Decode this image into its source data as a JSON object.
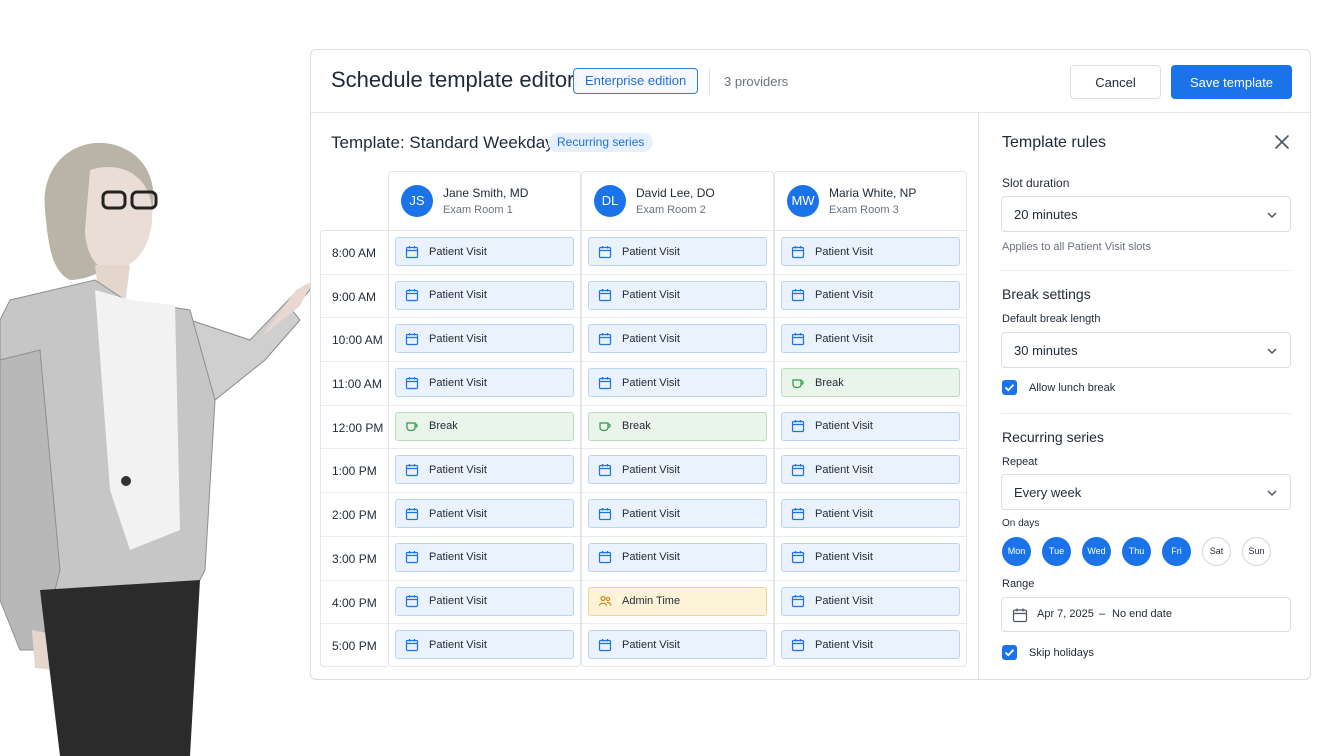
{
  "header": {
    "title": "Schedule template editor",
    "edition_badge": "Enterprise edition",
    "providers_count": "3 providers",
    "cancel_label": "Cancel",
    "save_label": "Save template"
  },
  "template": {
    "title": "Template: Standard Weekday",
    "badge": "Recurring series"
  },
  "times": [
    "8:00 AM",
    "9:00 AM",
    "10:00 AM",
    "11:00 AM",
    "12:00 PM",
    "1:00 PM",
    "2:00 PM",
    "3:00 PM",
    "4:00 PM",
    "5:00 PM"
  ],
  "providers": [
    {
      "initials": "JS",
      "name": "Jane Smith, MD",
      "room": "Exam Room 1",
      "slots": [
        {
          "label": "Patient Visit",
          "kind": "visit"
        },
        {
          "label": "Patient Visit",
          "kind": "visit"
        },
        {
          "label": "Patient Visit",
          "kind": "visit"
        },
        {
          "label": "Patient Visit",
          "kind": "visit"
        },
        {
          "label": "Break",
          "kind": "break"
        },
        {
          "label": "Patient Visit",
          "kind": "visit"
        },
        {
          "label": "Patient Visit",
          "kind": "visit"
        },
        {
          "label": "Patient Visit",
          "kind": "visit"
        },
        {
          "label": "Patient Visit",
          "kind": "visit"
        },
        {
          "label": "Patient Visit",
          "kind": "visit"
        }
      ]
    },
    {
      "initials": "DL",
      "name": "David Lee, DO",
      "room": "Exam Room 2",
      "slots": [
        {
          "label": "Patient Visit",
          "kind": "visit"
        },
        {
          "label": "Patient Visit",
          "kind": "visit"
        },
        {
          "label": "Patient Visit",
          "kind": "visit"
        },
        {
          "label": "Patient Visit",
          "kind": "visit"
        },
        {
          "label": "Break",
          "kind": "break"
        },
        {
          "label": "Patient Visit",
          "kind": "visit"
        },
        {
          "label": "Patient Visit",
          "kind": "visit"
        },
        {
          "label": "Patient Visit",
          "kind": "visit"
        },
        {
          "label": "Admin Time",
          "kind": "admin"
        },
        {
          "label": "Patient Visit",
          "kind": "visit"
        }
      ]
    },
    {
      "initials": "MW",
      "name": "Maria White, NP",
      "room": "Exam Room 3",
      "slots": [
        {
          "label": "Patient Visit",
          "kind": "visit"
        },
        {
          "label": "Patient Visit",
          "kind": "visit"
        },
        {
          "label": "Patient Visit",
          "kind": "visit"
        },
        {
          "label": "Break",
          "kind": "break"
        },
        {
          "label": "Patient Visit",
          "kind": "visit"
        },
        {
          "label": "Patient Visit",
          "kind": "visit"
        },
        {
          "label": "Patient Visit",
          "kind": "visit"
        },
        {
          "label": "Patient Visit",
          "kind": "visit"
        },
        {
          "label": "Patient Visit",
          "kind": "visit"
        },
        {
          "label": "Patient Visit",
          "kind": "visit"
        }
      ]
    }
  ],
  "rules": {
    "title": "Template rules",
    "slot_duration_label": "Slot duration",
    "slot_duration_value": "20 minutes",
    "slot_duration_hint": "Applies to all Patient Visit slots",
    "break_section": "Break settings",
    "break_length_label": "Default break length",
    "break_length_value": "30 minutes",
    "lunch_break_label": "Allow lunch break",
    "lunch_break_checked": true,
    "recurring_section": "Recurring series",
    "repeat_label": "Repeat",
    "repeat_value": "Every week",
    "days_label": "On days",
    "days": [
      {
        "label": "Mon",
        "on": true
      },
      {
        "label": "Tue",
        "on": true
      },
      {
        "label": "Wed",
        "on": true
      },
      {
        "label": "Thu",
        "on": true
      },
      {
        "label": "Fri",
        "on": true
      },
      {
        "label": "Sat",
        "on": false
      },
      {
        "label": "Sun",
        "on": false
      }
    ],
    "range_label": "Range",
    "range_start": "Apr 7, 2025",
    "range_separator": "–",
    "range_end": "No end date",
    "skip_holidays_label": "Skip holidays",
    "skip_holidays_checked": true
  },
  "colors": {
    "accent": "#1a73e8",
    "visit_bg": "#eaf2fd",
    "break_bg": "#e9f4ea",
    "admin_bg": "#fdf3d9"
  }
}
